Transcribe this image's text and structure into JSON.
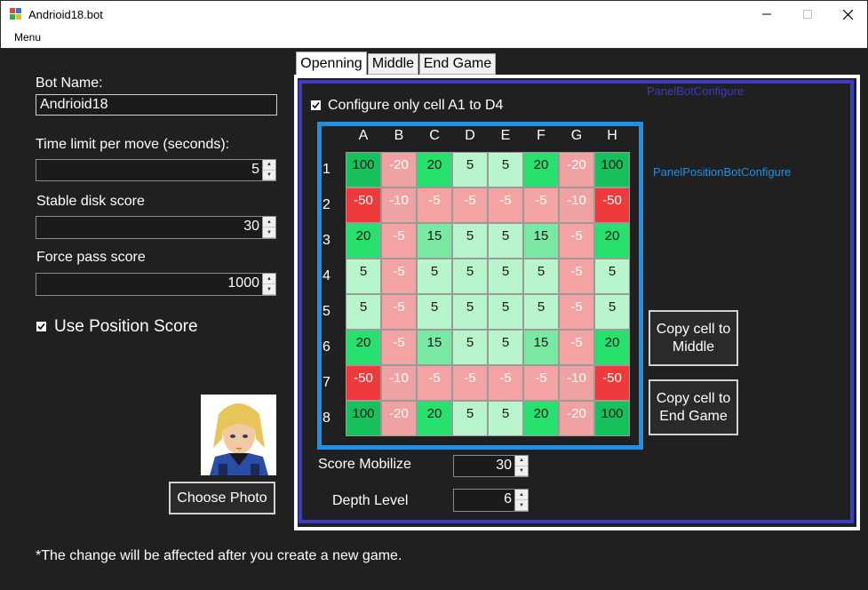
{
  "window": {
    "title": "Andrioid18.bot",
    "menu": [
      "Menu"
    ]
  },
  "left": {
    "bot_name_label": "Bot Name:",
    "bot_name_value": "Andrioid18",
    "time_limit_label": "Time limit per move (seconds):",
    "time_limit_value": "5",
    "stable_label": "Stable disk score",
    "stable_value": "30",
    "force_pass_label": "Force pass score",
    "force_pass_value": "1000",
    "use_position_label": "Use Position Score",
    "use_position_checked": true,
    "choose_photo_label": "Choose Photo",
    "note": "*The change will be affected after you create a new game."
  },
  "tabs": [
    {
      "label": "Openning",
      "active": true
    },
    {
      "label": "Middle",
      "active": false
    },
    {
      "label": "End Game",
      "active": false
    }
  ],
  "panel": {
    "name_label": "PanelBotConfigure",
    "position_panel_label": "PanelPositionBotConfigure",
    "configure_only_label": "Configure only cell A1 to D4",
    "configure_only_checked": true,
    "copy_middle_label": "Copy cell to Middle",
    "copy_end_label": "Copy cell to End Game",
    "score_mobilize_label": "Score Mobilize",
    "score_mobilize_value": "30",
    "depth_level_label": "Depth Level",
    "depth_level_value": "6"
  },
  "grid": {
    "columns": [
      "A",
      "B",
      "C",
      "D",
      "E",
      "F",
      "G",
      "H"
    ],
    "rows": [
      "1",
      "2",
      "3",
      "4",
      "5",
      "6",
      "7",
      "8"
    ],
    "values": [
      [
        "100",
        "-20",
        "20",
        "5",
        "5",
        "20",
        "-20",
        "100"
      ],
      [
        "-50",
        "-10",
        "-5",
        "-5",
        "-5",
        "-5",
        "-10",
        "-50"
      ],
      [
        "20",
        "-5",
        "15",
        "5",
        "5",
        "15",
        "-5",
        "20"
      ],
      [
        "5",
        "-5",
        "5",
        "5",
        "5",
        "5",
        "-5",
        "5"
      ],
      [
        "5",
        "-5",
        "5",
        "5",
        "5",
        "5",
        "-5",
        "5"
      ],
      [
        "20",
        "-5",
        "15",
        "5",
        "5",
        "15",
        "-5",
        "20"
      ],
      [
        "-50",
        "-10",
        "-5",
        "-5",
        "-5",
        "-5",
        "-10",
        "-50"
      ],
      [
        "100",
        "-20",
        "20",
        "5",
        "5",
        "20",
        "-20",
        "100"
      ]
    ]
  },
  "colors": {
    "panel_border": "#3b3bc4",
    "grid_border": "#1e90e6",
    "cell_100": "#16c05a",
    "cell_20": "#28e06e",
    "cell_15": "#79e8a2",
    "cell_5": "#b8f4cc",
    "cell_negative": "#f0a2a2",
    "cell_minus50": "#ee3a3a"
  }
}
